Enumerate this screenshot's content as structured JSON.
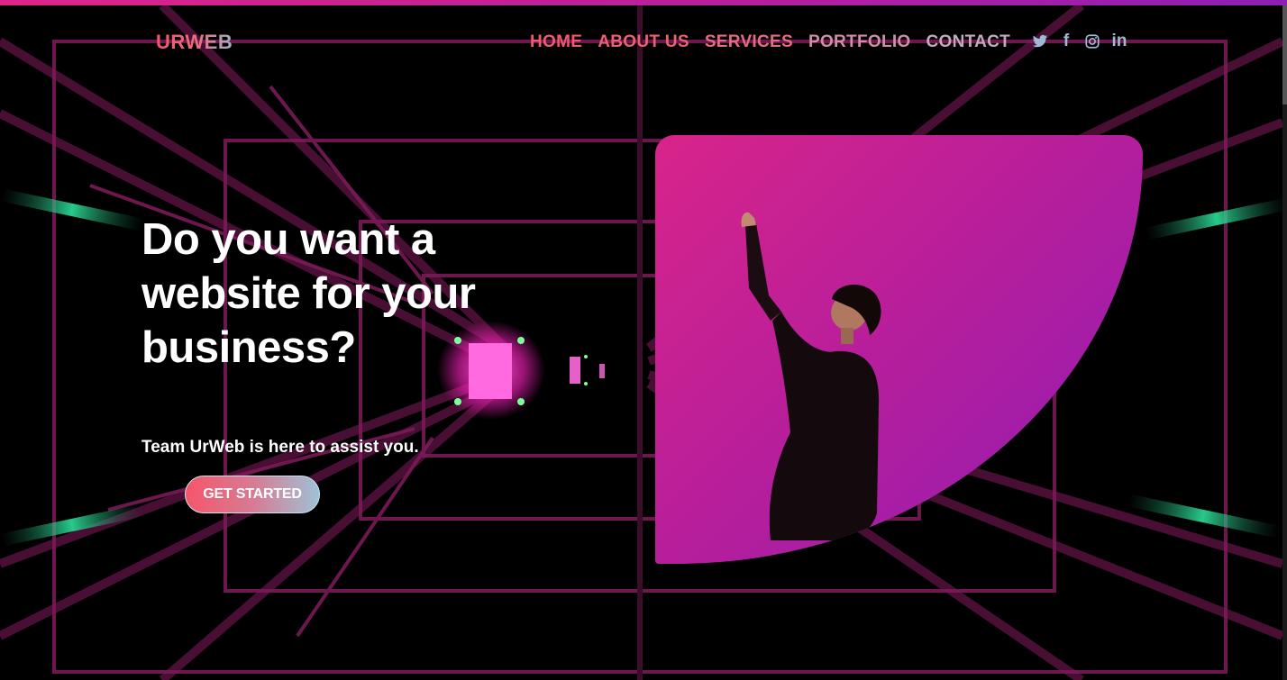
{
  "brand": {
    "logo": "URWEB"
  },
  "nav": {
    "items": [
      "HOME",
      "ABOUT US",
      "SERVICES",
      "PORTFOLIO",
      "CONTACT"
    ]
  },
  "social": {
    "icons": [
      "twitter-icon",
      "facebook-icon",
      "instagram-icon",
      "linkedin-icon"
    ],
    "facebook_glyph": "f",
    "linkedin_glyph": "in"
  },
  "hero": {
    "title": "Do you want a website for your business?",
    "subtitle": "Team UrWeb is here to assist you.",
    "cta_label": "GET STARTED"
  },
  "colors": {
    "accent_pink": "#e0248a",
    "accent_purple": "#8f1cb6",
    "nav_red": "#f15a6e",
    "social_blue": "#9fb8d4"
  }
}
